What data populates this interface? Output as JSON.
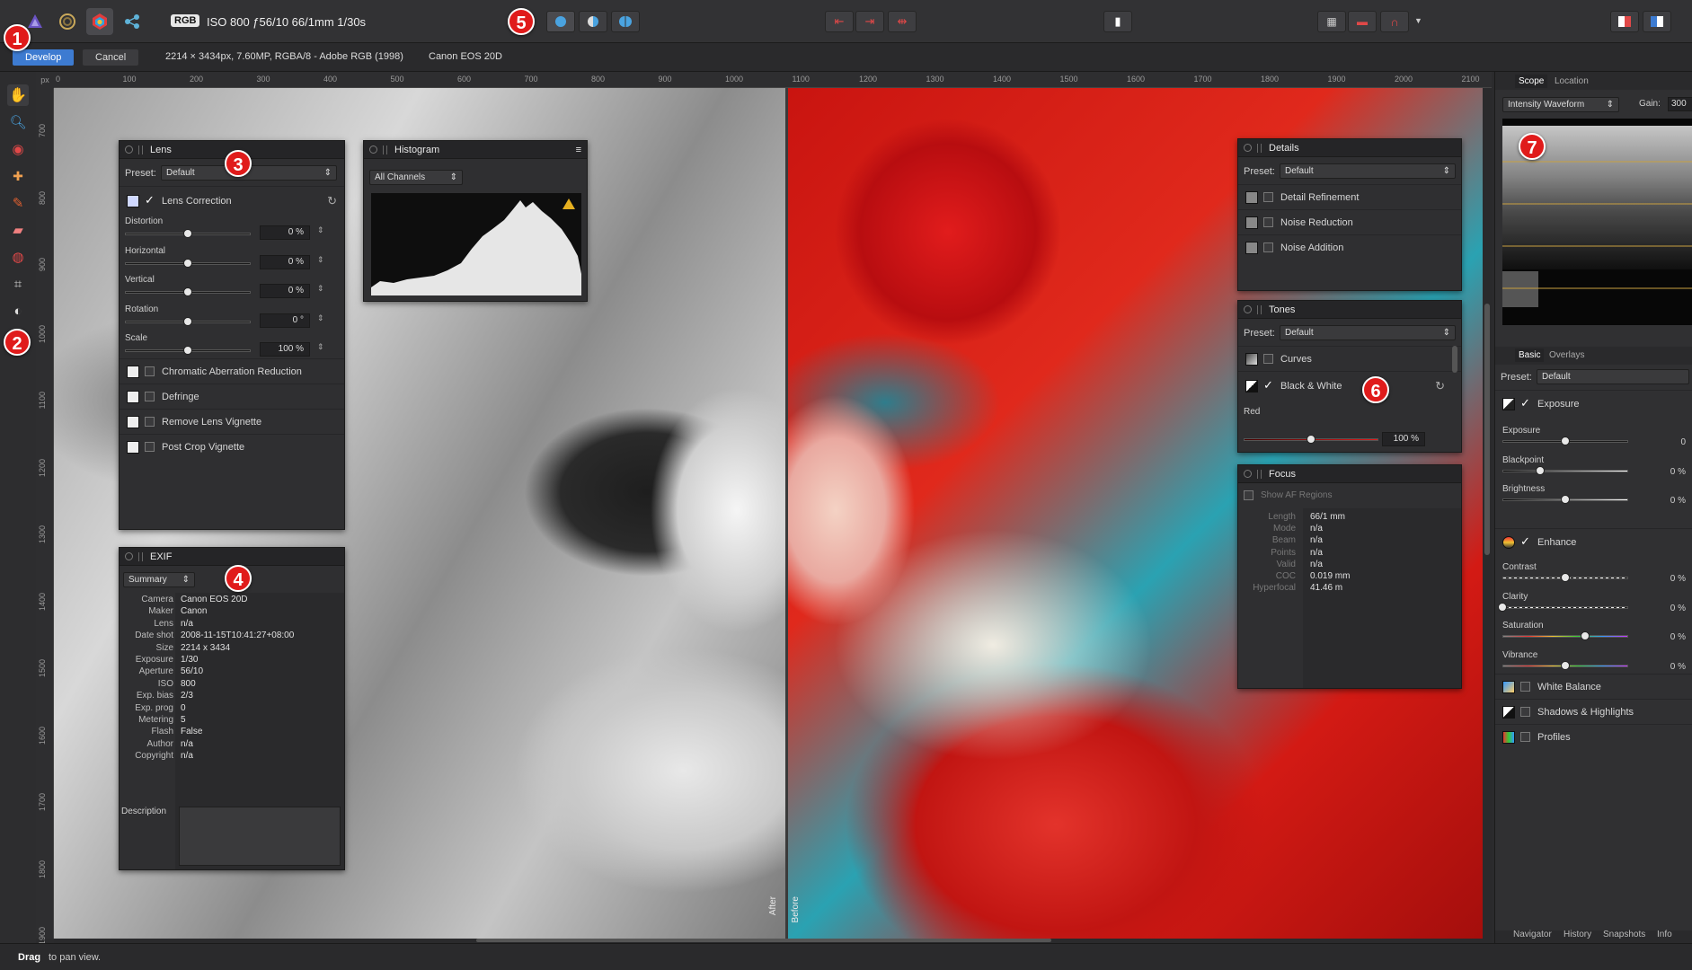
{
  "toolbar": {
    "personas": [
      "Photo Persona",
      "Liquify Persona",
      "Develop Persona",
      "Export Persona"
    ],
    "color_badge": "RGB",
    "exif_summary": "ISO 800 ƒ56/10 66/1mm 1/30s"
  },
  "context": {
    "develop_label": "Develop",
    "cancel_label": "Cancel",
    "image_info": "2214 × 3434px, 7.60MP, RGBA/8 - Adobe RGB (1998)",
    "camera": "Canon EOS 20D"
  },
  "ruler": {
    "unit": "px",
    "h_ticks": [
      "0",
      "100",
      "200",
      "300",
      "400",
      "500",
      "600",
      "700",
      "800",
      "900",
      "1000",
      "1100",
      "1200",
      "1300",
      "1400",
      "1500",
      "1600",
      "1700",
      "1800",
      "1900",
      "2000",
      "2100"
    ],
    "v_ticks": [
      "700",
      "800",
      "900",
      "1000",
      "1100",
      "1200",
      "1300",
      "1400",
      "1500",
      "1600",
      "1700",
      "1800",
      "1900"
    ]
  },
  "canvas": {
    "after_label": "After",
    "before_label": "Before"
  },
  "lens_panel": {
    "title": "Lens",
    "preset_label": "Preset:",
    "preset_value": "Default",
    "section": "Lens Correction",
    "sliders": [
      {
        "label": "Distortion",
        "value": "0 %",
        "fraction": 0.5
      },
      {
        "label": "Horizontal",
        "value": "0 %",
        "fraction": 0.5
      },
      {
        "label": "Vertical",
        "value": "0 %",
        "fraction": 0.5
      },
      {
        "label": "Rotation",
        "value": "0 °",
        "fraction": 0.5
      },
      {
        "label": "Scale",
        "value": "100 %",
        "fraction": 0.5
      }
    ],
    "options": [
      "Chromatic Aberration Reduction",
      "Defringe",
      "Remove Lens Vignette",
      "Post Crop Vignette"
    ]
  },
  "histogram_panel": {
    "title": "Histogram",
    "channel": "All Channels"
  },
  "exif_panel": {
    "title": "EXIF",
    "mode": "Summary",
    "rows": [
      {
        "k": "Camera",
        "v": "Canon EOS 20D"
      },
      {
        "k": "Maker",
        "v": "Canon"
      },
      {
        "k": "Lens",
        "v": "n/a"
      },
      {
        "k": "Date shot",
        "v": "2008-11-15T10:41:27+08:00"
      },
      {
        "k": "Size",
        "v": "2214 x 3434"
      },
      {
        "k": "Exposure",
        "v": "1/30"
      },
      {
        "k": "Aperture",
        "v": "56/10"
      },
      {
        "k": "ISO",
        "v": "800"
      },
      {
        "k": "Exp. bias",
        "v": "2/3"
      },
      {
        "k": "Exp. prog",
        "v": "0"
      },
      {
        "k": "Metering",
        "v": "5"
      },
      {
        "k": "Flash",
        "v": "False"
      },
      {
        "k": "Author",
        "v": "n/a"
      },
      {
        "k": "Copyright",
        "v": "n/a"
      }
    ],
    "description_label": "Description"
  },
  "details_panel": {
    "title": "Details",
    "preset_label": "Preset:",
    "preset_value": "Default",
    "options": [
      "Detail Refinement",
      "Noise Reduction",
      "Noise Addition"
    ]
  },
  "tones_panel": {
    "title": "Tones",
    "preset_label": "Preset:",
    "preset_value": "Default",
    "curves": "Curves",
    "bw": "Black & White",
    "red_label": "Red",
    "red_value": "100 %",
    "red_fraction": 0.5
  },
  "focus_panel": {
    "title": "Focus",
    "show_af": "Show AF Regions",
    "rows": [
      {
        "k": "Length",
        "v": "66/1 mm"
      },
      {
        "k": "Mode",
        "v": "n/a"
      },
      {
        "k": "Beam",
        "v": "n/a"
      },
      {
        "k": "Points",
        "v": "n/a"
      },
      {
        "k": "Valid",
        "v": "n/a"
      },
      {
        "k": "COC",
        "v": "0.019 mm"
      },
      {
        "k": "Hyperfocal",
        "v": "41.46 m"
      }
    ]
  },
  "studio": {
    "scope_tabs": [
      "Scope",
      "Location"
    ],
    "scope_mode": "Intensity Waveform",
    "gain_label": "Gain:",
    "gain_value": "300",
    "basic_tabs": [
      "Basic",
      "Overlays"
    ],
    "preset_label": "Preset:",
    "preset_value": "Default",
    "exposure_section": "Exposure",
    "exposure_sliders": [
      {
        "label": "Exposure",
        "value": "0",
        "fraction": 0.5
      },
      {
        "label": "Blackpoint",
        "value": "0 %",
        "fraction": 0.3
      },
      {
        "label": "Brightness",
        "value": "0 %",
        "fraction": 0.5
      }
    ],
    "enhance_section": "Enhance",
    "enhance_sliders": [
      {
        "label": "Contrast",
        "value": "0 %",
        "fraction": 0.5
      },
      {
        "label": "Clarity",
        "value": "0 %",
        "fraction": 0.0
      },
      {
        "label": "Saturation",
        "value": "0 %",
        "fraction": 0.66
      },
      {
        "label": "Vibrance",
        "value": "0 %",
        "fraction": 0.5
      }
    ],
    "other_sections": [
      "White Balance",
      "Shadows & Highlights",
      "Profiles"
    ],
    "bottom_tabs": [
      "Navigator",
      "History",
      "Snapshots",
      "Info"
    ]
  },
  "status": {
    "bold": "Drag",
    "text": "to pan view."
  },
  "callouts": [
    "1",
    "2",
    "3",
    "4",
    "5",
    "6",
    "7"
  ],
  "colors": {
    "accent": "#3d7bd1",
    "callout": "#e01b1b",
    "waveform_line": "#c8a040"
  }
}
